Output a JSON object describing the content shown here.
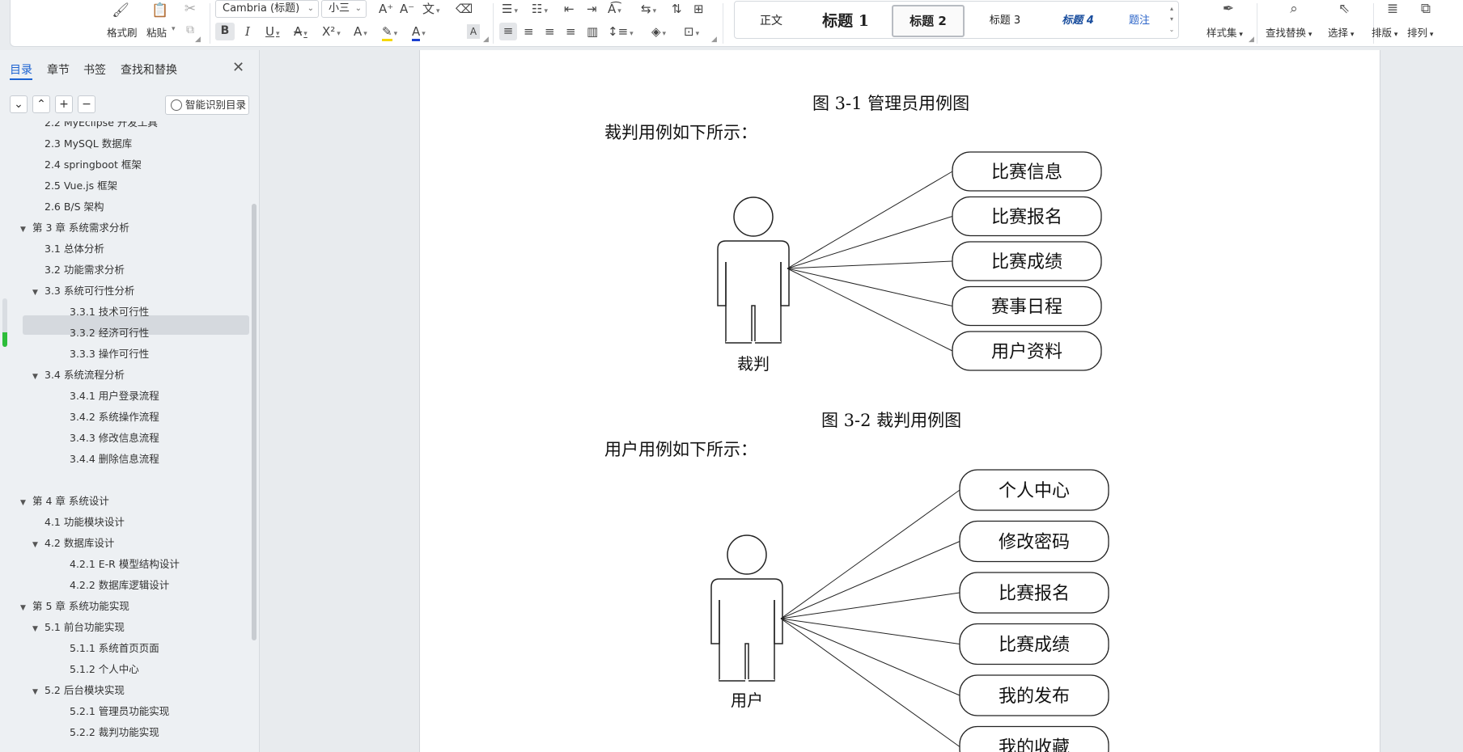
{
  "ribbon": {
    "format_painter": "格式刷",
    "paste": "粘贴",
    "font_name": "Cambria (标题)",
    "font_size": "小三",
    "styles": {
      "body": "正文",
      "h1": "标题 1",
      "h2": "标题 2",
      "h3": "标题 3",
      "h4": "标题 4",
      "caption": "题注"
    },
    "style_set": "样式集",
    "find_replace": "查找替换",
    "select": "选择",
    "layout": "排版",
    "arrange": "排列"
  },
  "sidebar": {
    "tabs": [
      "目录",
      "章节",
      "书签",
      "查找和替换"
    ],
    "smart_toc": "智能识别目录",
    "reading_progress": 0.3,
    "toc": [
      {
        "label": "2.2 MyEclipse 开发工具",
        "level": 2,
        "expand": ""
      },
      {
        "label": "2.3 MySQL 数据库",
        "level": 2,
        "expand": ""
      },
      {
        "label": "2.4 springboot 框架",
        "level": 2,
        "expand": ""
      },
      {
        "label": "2.5 Vue.js 框架",
        "level": 2,
        "expand": ""
      },
      {
        "label": "2.6 B/S 架构",
        "level": 2,
        "expand": ""
      },
      {
        "label": "第 3 章  系统需求分析",
        "level": 1,
        "expand": "▼"
      },
      {
        "label": "3.1 总体分析",
        "level": 2,
        "expand": ""
      },
      {
        "label": "3.2 功能需求分析",
        "level": 2,
        "expand": ""
      },
      {
        "label": "3.3  系统可行性分析",
        "level": 2,
        "expand": "▼"
      },
      {
        "label": "3.3.1 技术可行性",
        "level": 3,
        "expand": ""
      },
      {
        "label": "3.3.2 经济可行性",
        "level": 3,
        "expand": ""
      },
      {
        "label": "3.3.3 操作可行性",
        "level": 3,
        "expand": ""
      },
      {
        "label": "3.4 系统流程分析",
        "level": 2,
        "expand": "▼"
      },
      {
        "label": "3.4.1  用户登录流程",
        "level": 3,
        "expand": ""
      },
      {
        "label": "3.4.2  系统操作流程",
        "level": 3,
        "expand": ""
      },
      {
        "label": "3.4.3 修改信息流程",
        "level": 3,
        "expand": ""
      },
      {
        "label": "3.4.4 删除信息流程",
        "level": 3,
        "expand": ""
      },
      {
        "label": "",
        "level": 0,
        "expand": ""
      },
      {
        "label": "第 4 章  系统设计",
        "level": 1,
        "expand": "▼"
      },
      {
        "label": "4.1  功能模块设计",
        "level": 2,
        "expand": ""
      },
      {
        "label": "4.2  数据库设计",
        "level": 2,
        "expand": "▼"
      },
      {
        "label": "4.2.1 E-R 模型结构设计",
        "level": 3,
        "expand": ""
      },
      {
        "label": "4.2.2  数据库逻辑设计",
        "level": 3,
        "expand": ""
      },
      {
        "label": "第 5 章  系统功能实现",
        "level": 1,
        "expand": "▼"
      },
      {
        "label": "5.1 前台功能实现",
        "level": 2,
        "expand": "▼"
      },
      {
        "label": "5.1.1 系统首页页面",
        "level": 3,
        "expand": ""
      },
      {
        "label": "5.1.2 个人中心",
        "level": 3,
        "expand": ""
      },
      {
        "label": "5.2 后台模块实现",
        "level": 2,
        "expand": "▼"
      },
      {
        "label": "5.2.1 管理员功能实现",
        "level": 3,
        "expand": ""
      },
      {
        "label": "5.2.2 裁判功能实现",
        "level": 3,
        "expand": ""
      }
    ]
  },
  "document": {
    "caption1": "图 3-1  管理员用例图",
    "intro_referee": "裁判用例如下所示：",
    "referee_actor": "裁判",
    "referee_cases": [
      "比赛信息",
      "比赛报名",
      "比赛成绩",
      "赛事日程",
      "用户资料"
    ],
    "caption2": "图 3-2  裁判用例图",
    "intro_user": "用户用例如下所示：",
    "user_actor": "用户",
    "user_cases": [
      "个人中心",
      "修改密码",
      "比赛报名",
      "比赛成绩",
      "我的发布",
      "我的收藏"
    ]
  }
}
